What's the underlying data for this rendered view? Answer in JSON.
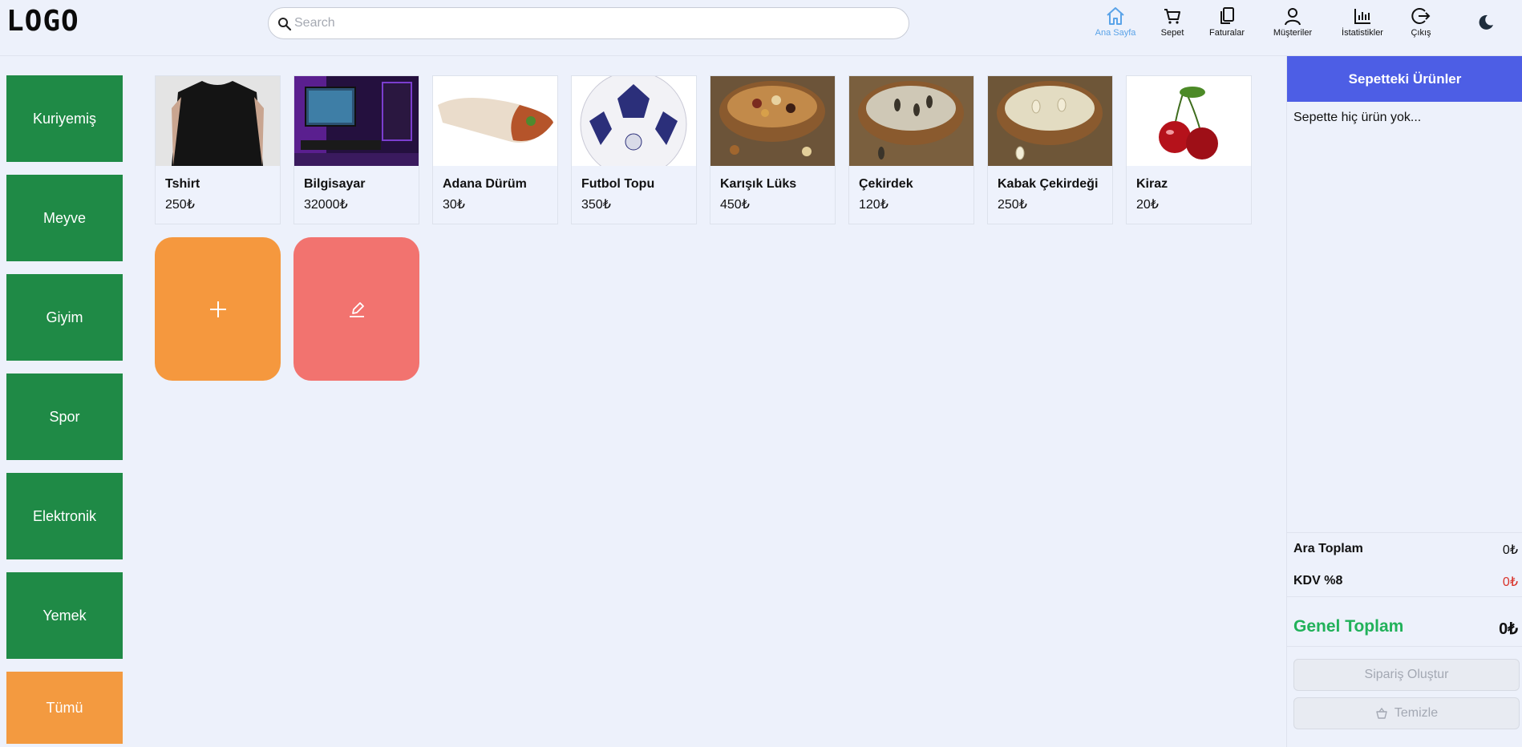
{
  "header": {
    "logo": "LOGO",
    "search": {
      "placeholder": "Search",
      "value": ""
    },
    "nav": [
      {
        "label": "Ana Sayfa",
        "icon": "home-icon",
        "active": true
      },
      {
        "label": "Sepet",
        "icon": "cart-icon"
      },
      {
        "label": "Faturalar",
        "icon": "invoices-icon"
      },
      {
        "label": "Müşteriler",
        "icon": "user-icon"
      },
      {
        "label": "İstatistikler",
        "icon": "chart-icon"
      },
      {
        "label": "Çıkış",
        "icon": "logout-icon"
      }
    ],
    "theme_toggle_icon": "moon-icon"
  },
  "sidebar": {
    "categories": [
      {
        "label": "Kuriyemiş"
      },
      {
        "label": "Meyve"
      },
      {
        "label": "Giyim"
      },
      {
        "label": "Spor"
      },
      {
        "label": "Elektronik"
      },
      {
        "label": "Yemek"
      },
      {
        "label": "Tümü",
        "active": true
      }
    ]
  },
  "products": [
    {
      "name": "Tshirt",
      "price": "250₺",
      "image": "black t-shirt"
    },
    {
      "name": "Bilgisayar",
      "price": "32000₺",
      "image": "gaming desk setup"
    },
    {
      "name": "Adana Dürüm",
      "price": "30₺",
      "image": "wrap"
    },
    {
      "name": "Futbol Topu",
      "price": "350₺",
      "image": "football"
    },
    {
      "name": "Karışık Lüks",
      "price": "450₺",
      "image": "mixed nuts"
    },
    {
      "name": "Çekirdek",
      "price": "120₺",
      "image": "sunflower seeds"
    },
    {
      "name": "Kabak Çekirdeği",
      "price": "250₺",
      "image": "pumpkin seeds"
    },
    {
      "name": "Kiraz",
      "price": "20₺",
      "image": "cherries"
    }
  ],
  "actions": {
    "add_icon": "plus-icon",
    "edit_icon": "edit-icon"
  },
  "cart": {
    "title": "Sepetteki Ürünler",
    "empty_text": "Sepette hiç ürün yok...",
    "subtotal_label": "Ara Toplam",
    "subtotal_value": "0₺",
    "tax_label": "KDV %8",
    "tax_value": "0₺",
    "total_label": "Genel Toplam",
    "total_value": "0₺",
    "order_button": "Sipariş Oluştur",
    "clear_button": "Temizle"
  },
  "colors": {
    "background": "#edf1fb",
    "category_green": "#1f8a46",
    "category_active_orange": "#f39a40",
    "add_orange": "#f5983e",
    "edit_red": "#f2736f",
    "cart_header_blue": "#4d5ee5",
    "total_green": "#21b15a",
    "tax_red": "#d9342b",
    "nav_active_blue": "#5aa3e8"
  }
}
